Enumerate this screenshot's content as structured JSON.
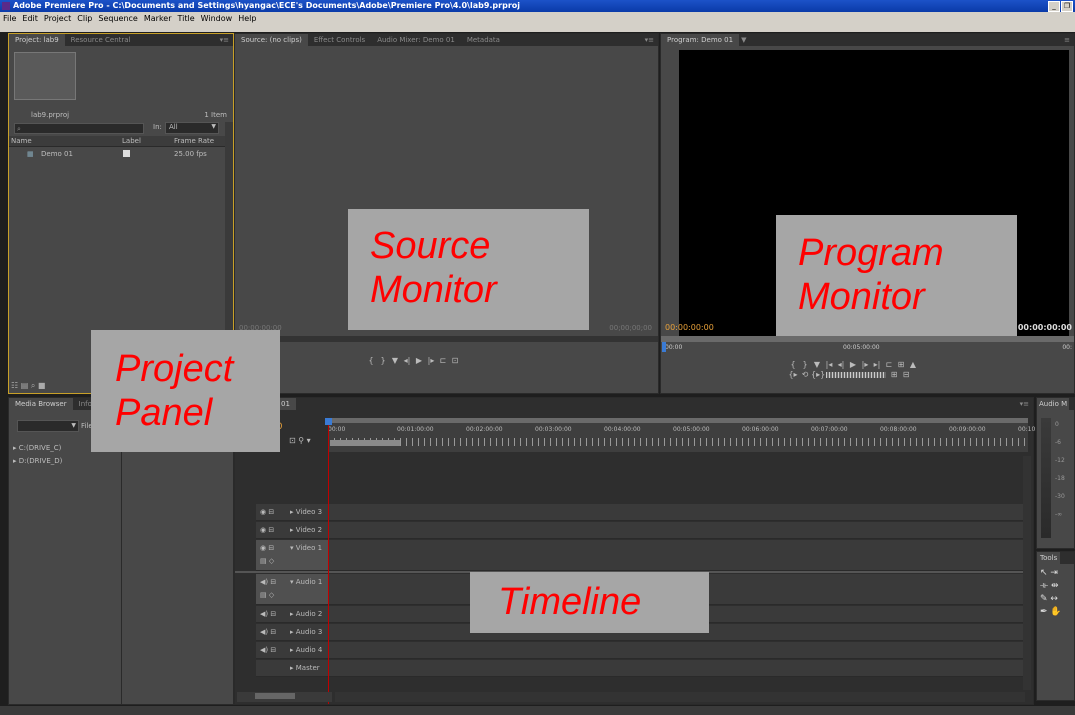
{
  "window": {
    "title": "Adobe Premiere Pro - C:\\Documents and Settings\\hyangac\\ECE's Documents\\Adobe\\Premiere Pro\\4.0\\lab9.prproj"
  },
  "menu": [
    "File",
    "Edit",
    "Project",
    "Clip",
    "Sequence",
    "Marker",
    "Title",
    "Window",
    "Help"
  ],
  "project": {
    "tabs": [
      "Project: lab9",
      "Resource Central"
    ],
    "file_name": "lab9.prproj",
    "item_count": "1 Item",
    "search_placeholder": "",
    "in_label": "In:",
    "in_value": "All",
    "columns": [
      "Name",
      "Label",
      "Frame Rate"
    ],
    "items": [
      {
        "name": "Demo 01",
        "fps": "25.00 fps"
      }
    ]
  },
  "source": {
    "tabs": [
      "Source: (no clips)",
      "Effect Controls",
      "Audio Mixer: Demo 01",
      "Metadata"
    ],
    "tc_left": "00:00:00:00",
    "tc_right": "00;00;00;00"
  },
  "program": {
    "tab": "Program: Demo 01",
    "tc_left": "00:00:00:00",
    "tc_right": "00:00:00:00",
    "ruler": [
      "00:00",
      "00:05:00:00",
      "00:"
    ]
  },
  "media": {
    "tabs": [
      "Media Browser",
      "Info"
    ],
    "files_label": "File",
    "drives": [
      "C:(DRIVE_C)",
      "D:(DRIVE_D)"
    ]
  },
  "timeline": {
    "tab_suffix": "01",
    "current_tc": "00",
    "ruler": [
      "00:00",
      "00:01:00:00",
      "00:02:00:00",
      "00:03:00:00",
      "00:04:00:00",
      "00:05:00:00",
      "00:06:00:00",
      "00:07:00:00",
      "00:08:00:00",
      "00:09:00:00",
      "00:10:"
    ],
    "tracks": [
      "Video 3",
      "Video 2",
      "Video 1",
      "Audio 1",
      "Audio 2",
      "Audio 3",
      "Audio 4",
      "Master"
    ]
  },
  "audio_meter": {
    "tab": "Audio M",
    "scale": [
      "0",
      "-6",
      "-12",
      "-18",
      "-30",
      "-∞"
    ]
  },
  "tools": {
    "tab": "Tools"
  },
  "labels": {
    "source": "Source Monitor",
    "program": "Program Monitor",
    "project": "Project Panel",
    "timeline": "Timeline"
  },
  "colors": {
    "timecode": "#e8a13a",
    "annotation_text": "#ff0000",
    "annotation_bg": "#a6a6a6",
    "playhead": "#c00000"
  }
}
